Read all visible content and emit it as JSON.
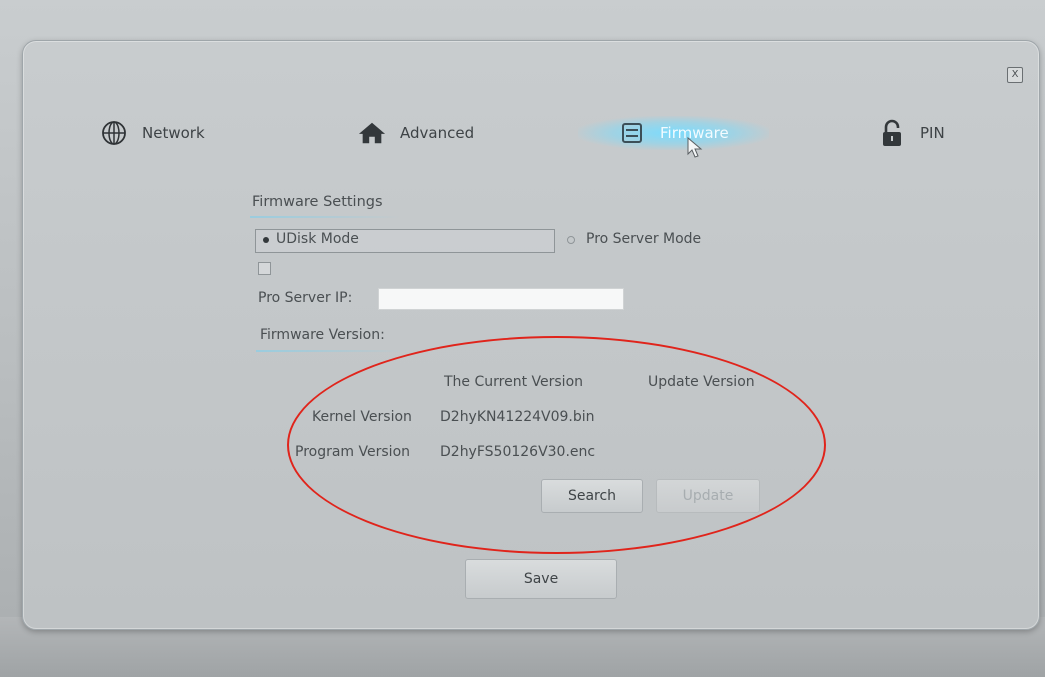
{
  "window": {
    "close_label": "X"
  },
  "tabs": [
    {
      "label": "Network",
      "icon": "globe-icon"
    },
    {
      "label": "Advanced",
      "icon": "home-icon"
    },
    {
      "label": "Firmware",
      "icon": "firmware-chip-icon",
      "active": true
    },
    {
      "label": "PIN",
      "icon": "lock-icon"
    }
  ],
  "firmware_settings": {
    "heading": "Firmware Settings",
    "modes": [
      {
        "label": "UDisk Mode",
        "selected": true
      },
      {
        "label": "Pro Server Mode",
        "selected": false
      }
    ],
    "checkbox_checked": false,
    "pro_server_ip_label": "Pro Server IP:",
    "pro_server_ip_value": "",
    "version_heading": "Firmware Version:"
  },
  "version_table": {
    "columns": [
      "The Current Version",
      "Update Version"
    ],
    "rows": [
      {
        "label": "Kernel Version",
        "current": "D2hyKN41224V09.bin",
        "update": ""
      },
      {
        "label": "Program Version",
        "current": "D2hyFS50126V30.enc",
        "update": ""
      }
    ]
  },
  "buttons": {
    "search": "Search",
    "update": "Update",
    "save": "Save"
  },
  "colors": {
    "active_tab_glow": "#78dcff",
    "highlight": "#e0241b"
  }
}
